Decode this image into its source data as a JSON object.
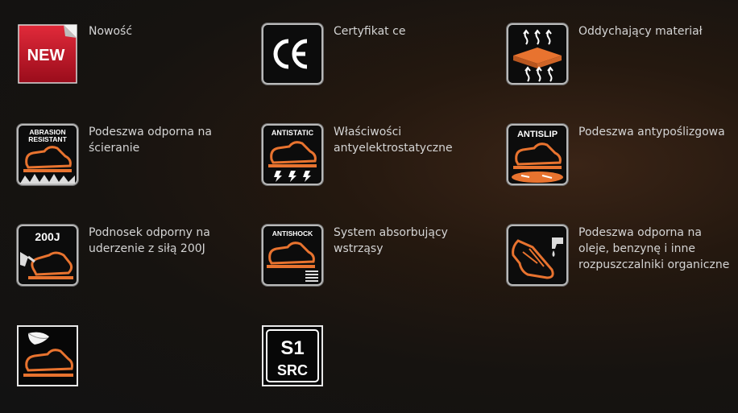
{
  "features": [
    {
      "icon": "new-badge-icon",
      "icon_text": "NEW",
      "label": "Nowość"
    },
    {
      "icon": "ce-mark-icon",
      "icon_text": "CE",
      "label": "Certyfikat ce"
    },
    {
      "icon": "breathable-material-icon",
      "icon_text": "",
      "label": "Oddychający materiał"
    },
    {
      "icon": "abrasion-resistant-icon",
      "icon_text": "ABRASION RESISTANT",
      "label": "Podeszwa odporna na ścieranie"
    },
    {
      "icon": "antistatic-icon",
      "icon_text": "ANTISTATIC",
      "label": "Właściwości antyelektrostatyczne"
    },
    {
      "icon": "antislip-icon",
      "icon_text": "ANTISLIP",
      "label": "Podeszwa antypoślizgowa"
    },
    {
      "icon": "toecap-200j-icon",
      "icon_text": "200J",
      "label": "Podnosek odporny na uderzenie z siłą 200J"
    },
    {
      "icon": "antishock-icon",
      "icon_text": "ANTISHOCK",
      "label": "System absorbujący wstrząsy"
    },
    {
      "icon": "oil-resistant-sole-icon",
      "icon_text": "",
      "label": "Podeszwa odporna na oleje, benzynę i inne rozpuszczalniki organiczne"
    },
    {
      "icon": "lightweight-feather-icon",
      "icon_text": "",
      "label": ""
    },
    {
      "icon": "s1-src-icon",
      "icon_text": "S1 SRC",
      "label": ""
    }
  ],
  "colors": {
    "accent_orange": "#e8732f",
    "new_red": "#c8102e",
    "icon_border": "#b9b9b9"
  }
}
